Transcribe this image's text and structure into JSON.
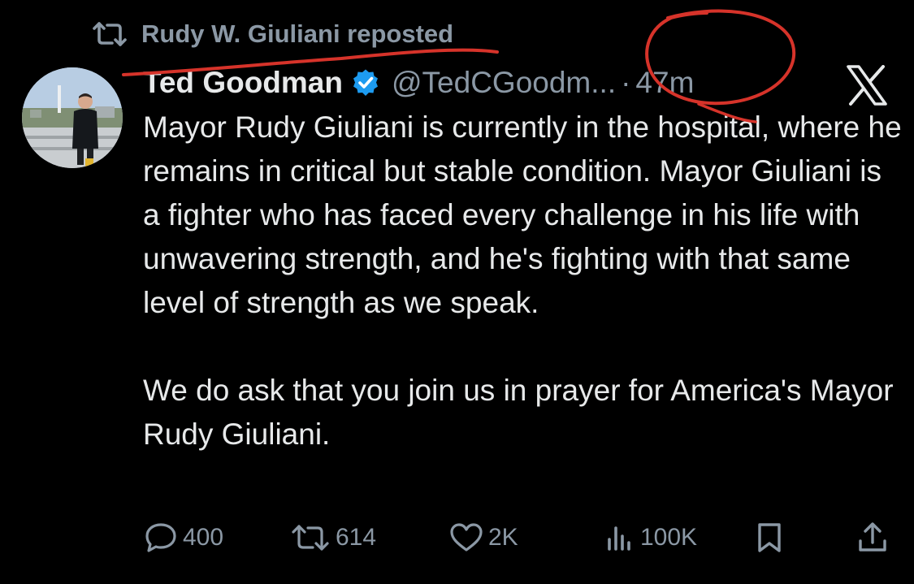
{
  "repost": {
    "label": "Rudy W. Giuliani reposted",
    "icon": "retweet-icon"
  },
  "tweet": {
    "display_name": "Ted Goodman",
    "verified_icon": "verified-badge-icon",
    "handle": "@TedCGoodm...",
    "separator": "·",
    "time": "47m",
    "paragraphs": [
      "Mayor Rudy Giuliani is currently in the hospital, where he remains in critical but stable condition. Mayor Giuliani is a fighter who has faced every challenge in his life with unwavering strength, and he's fighting with that same level of strength as we speak.",
      "We do ask that you join us in prayer for America's Mayor Rudy Giuliani."
    ]
  },
  "actions": {
    "replies": "400",
    "reposts": "614",
    "likes": "2K",
    "views": "100K",
    "icons": [
      "reply-icon",
      "retweet-icon",
      "heart-icon",
      "views-icon",
      "bookmark-icon",
      "share-icon"
    ]
  },
  "colors": {
    "background": "#000000",
    "text": "#e7e9ea",
    "secondary": "#8b98a5",
    "verified": "#1d9bf0",
    "annotation": "#d6332a"
  }
}
